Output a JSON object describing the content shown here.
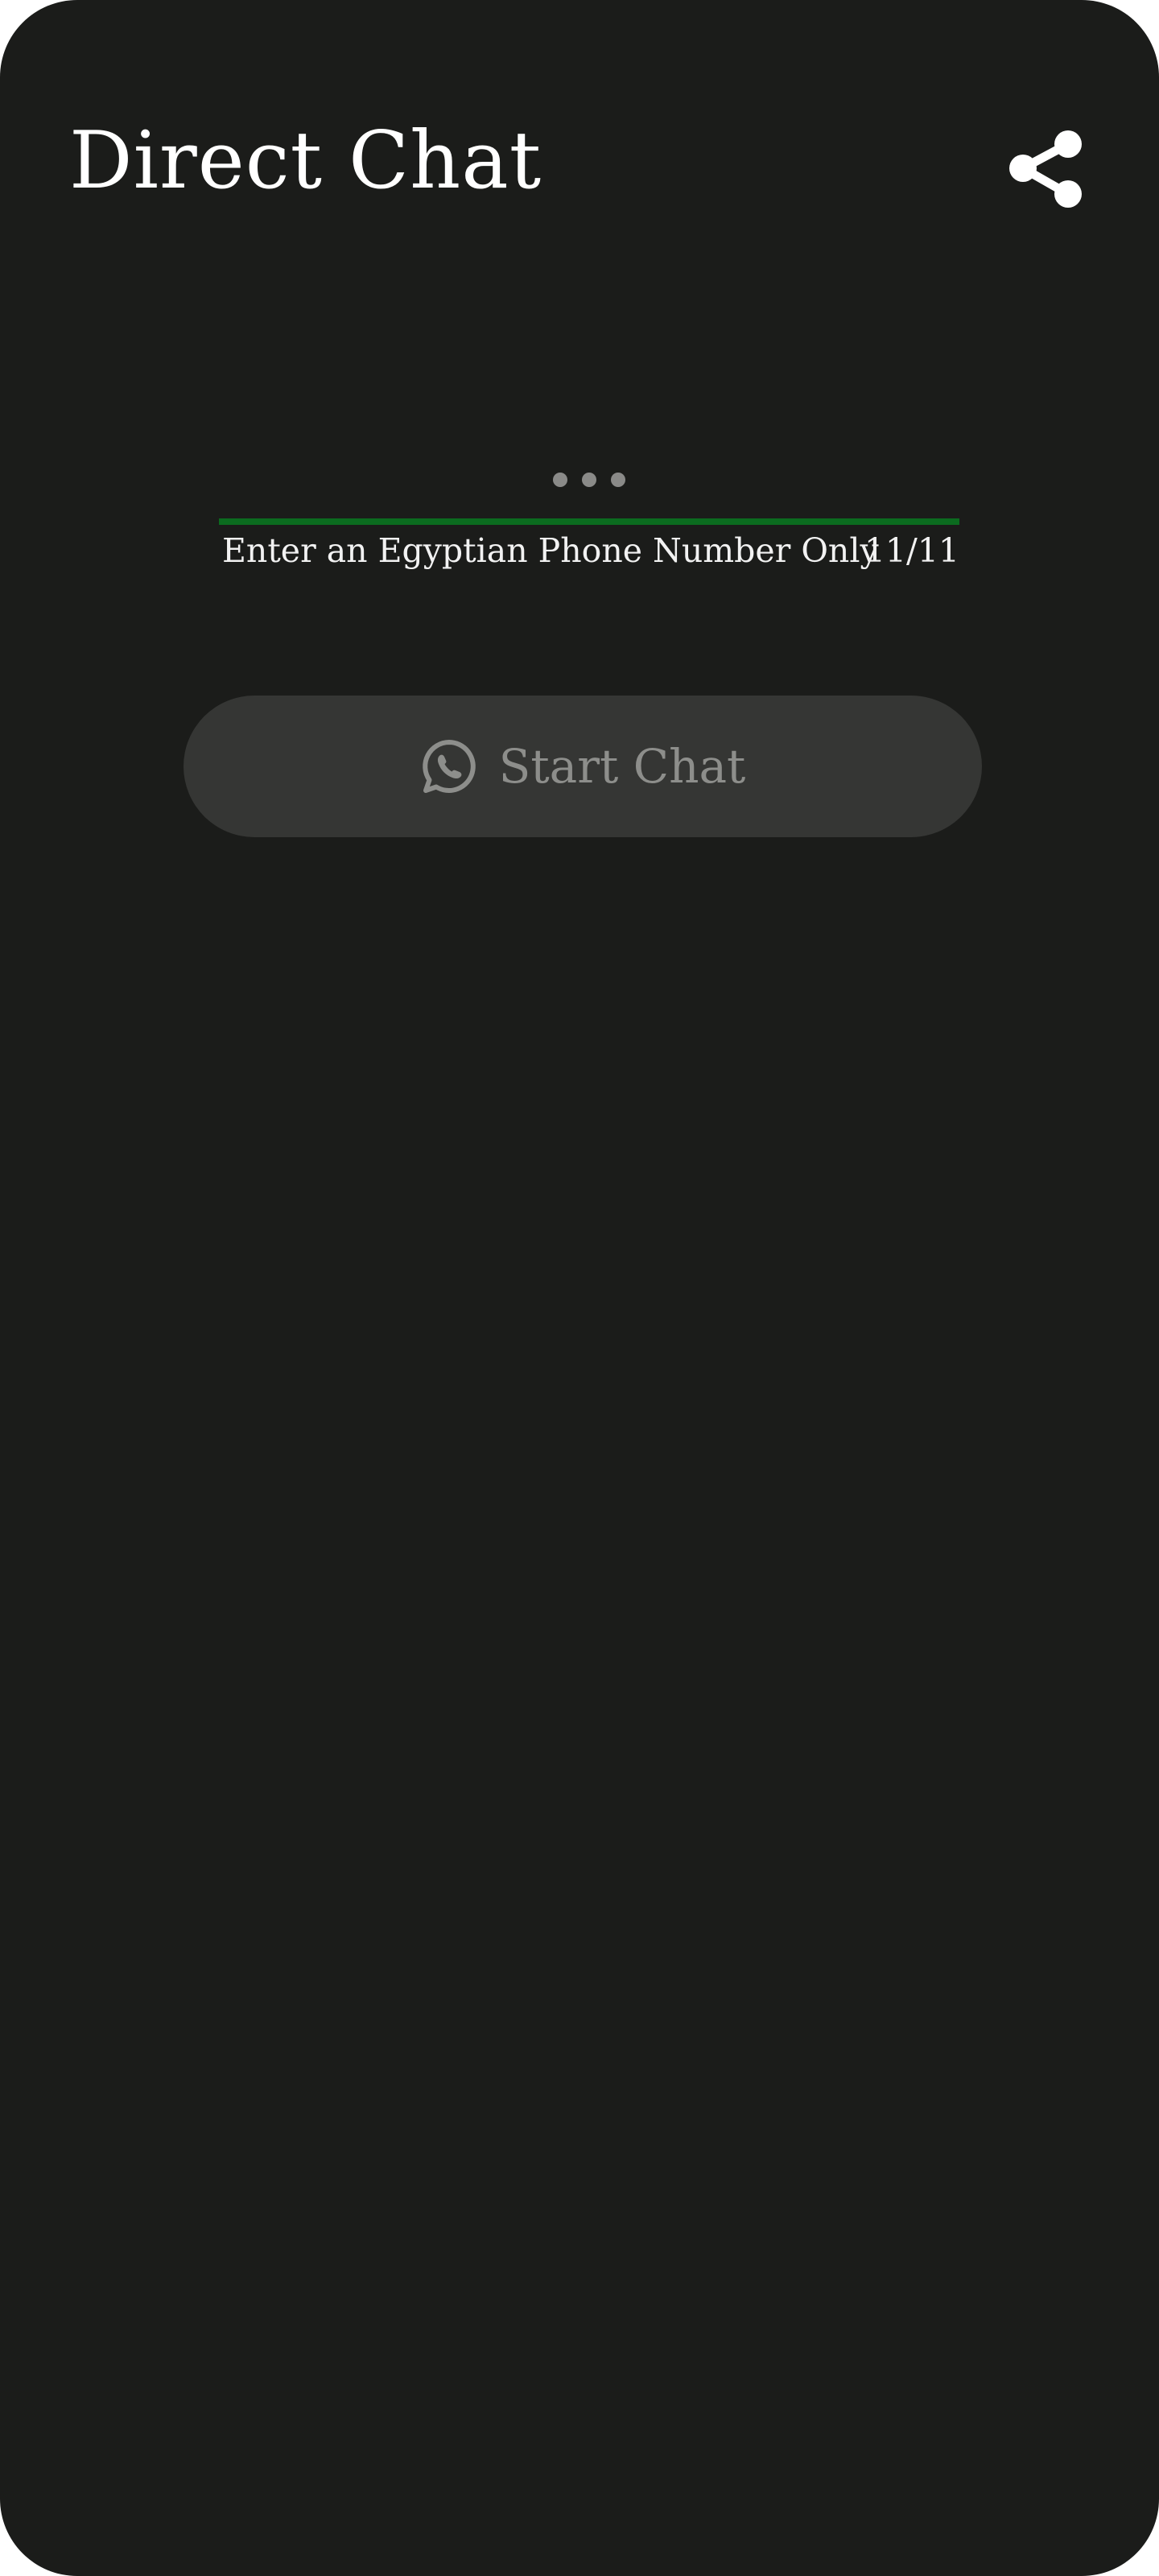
{
  "app": {
    "title": "Direct Chat"
  },
  "toolbar": {
    "share_icon": "share-icon"
  },
  "phone_input": {
    "masked_value": "•••",
    "helper_text": "Enter an Egyptian Phone Number Only",
    "counter": "11/11",
    "underline_color": "#0b6b1f"
  },
  "start_button": {
    "label": "Start Chat",
    "icon": "whatsapp-icon",
    "background": "#353634",
    "text_color": "#8d8e8b"
  },
  "colors": {
    "background": "#1b1c1a",
    "text": "#ffffff"
  }
}
